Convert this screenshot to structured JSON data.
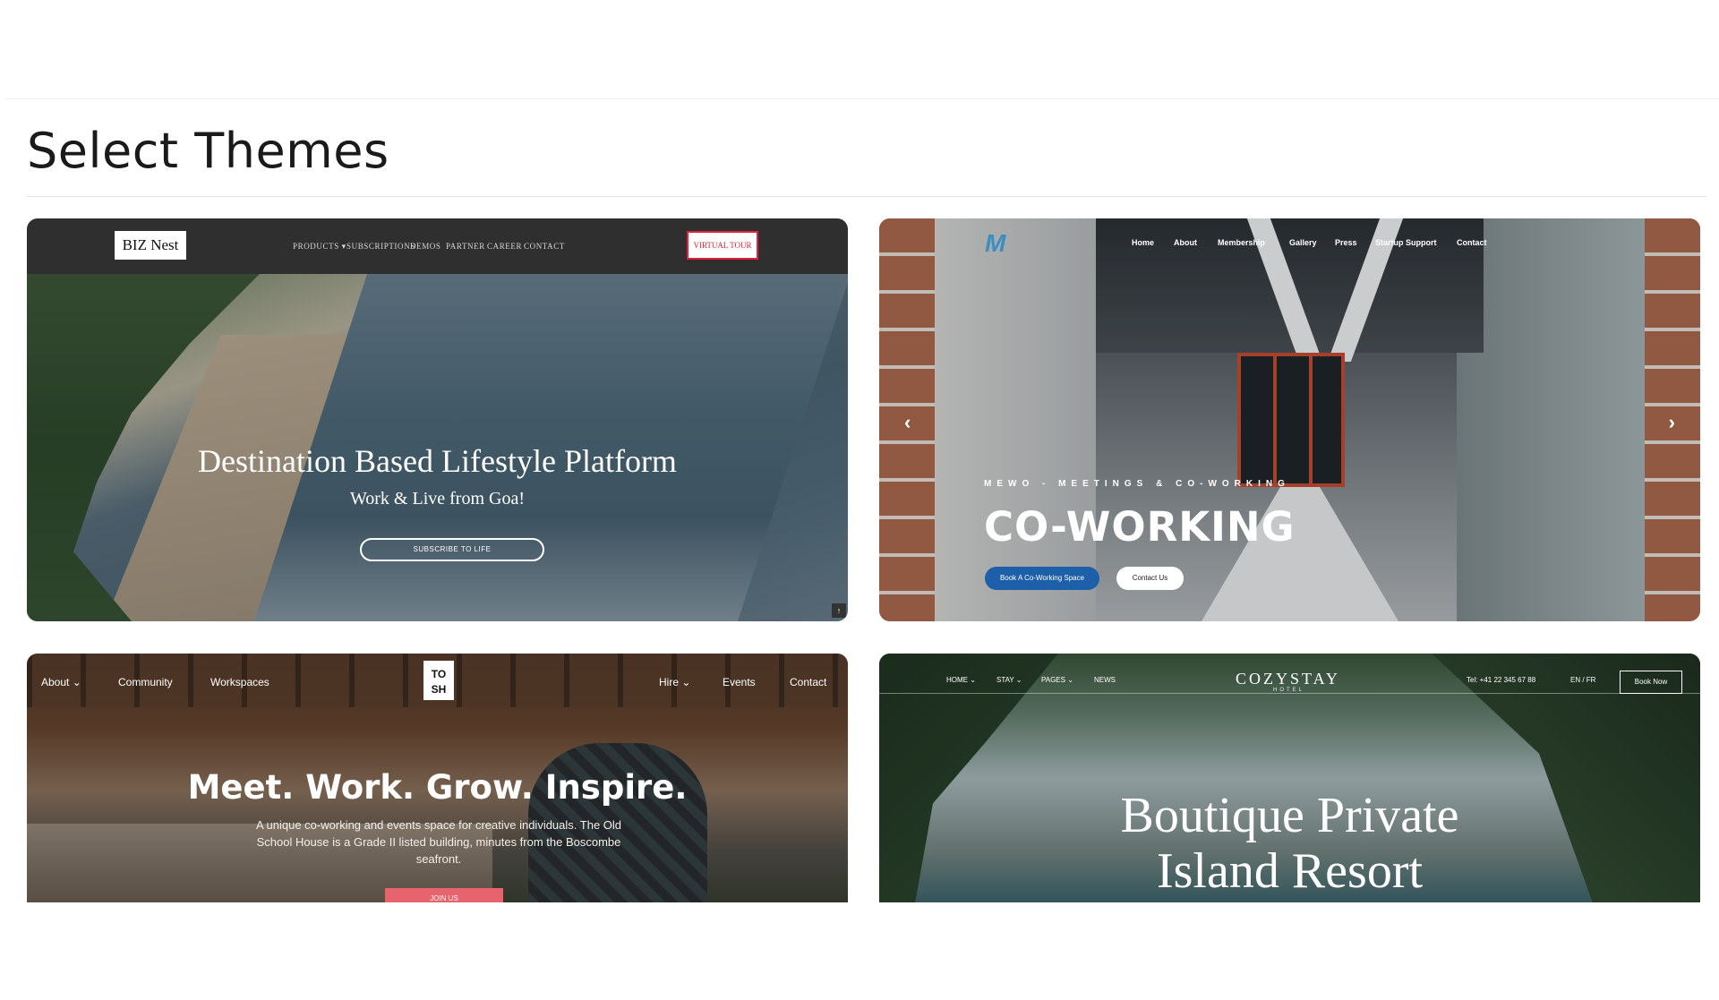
{
  "page": {
    "title": "Select Themes"
  },
  "themes": [
    {
      "name": "BIZ Nest",
      "logo": "BIZ Nest",
      "nav": [
        "PRODUCTS ▾",
        "SUBSCRIPTIONS",
        "DEMOS",
        "PARTNER",
        "CAREER",
        "CONTACT"
      ],
      "cta": "VIRTUAL TOUR",
      "headline": "Destination Based Lifestyle Platform",
      "subhead": "Work & Live from Goa!",
      "button": "SUBSCRIBE TO LIFE",
      "scroll_up": "↑"
    },
    {
      "name": "MEWO",
      "logo": "M",
      "nav": [
        "Home",
        "About",
        "Membership",
        "Gallery",
        "Press",
        "Startup Support",
        "Contact"
      ],
      "eyebrow": "MEWO - MEETINGS & CO-WORKING",
      "headline": "CO-WORKING",
      "button_primary": "Book A Co-Working Space",
      "button_secondary": "Contact Us",
      "prev": "‹",
      "next": "›"
    },
    {
      "name": "TOSH",
      "logo": "TO SH",
      "nav_left": [
        "About ⌄",
        "Community",
        "Workspaces"
      ],
      "nav_right": [
        "Hire ⌄",
        "Events",
        "Contact"
      ],
      "headline": "Meet. Work. Grow. Inspire.",
      "description": "A unique co-working and events space for creative individuals. The Old School House is a Grade II listed building, minutes from the Boscombe seafront.",
      "button": "JOIN US"
    },
    {
      "name": "COZYSTAY",
      "brand": "COZYSTAY",
      "brand_sub": "HOTEL",
      "nav": [
        "HOME ⌄",
        "STAY ⌄",
        "PAGES ⌄",
        "NEWS"
      ],
      "phone": "Tel: +41 22 345 67 88",
      "language": "EN / FR",
      "book": "Book Now",
      "headline_line1": "Boutique Private",
      "headline_line2": "Island Resort"
    }
  ]
}
